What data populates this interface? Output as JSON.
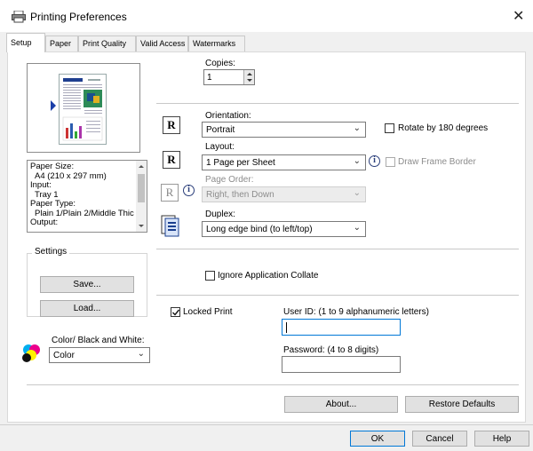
{
  "window": {
    "title": "Printing Preferences",
    "close_glyph": "✕"
  },
  "tabs": [
    {
      "label": "Setup",
      "active": true
    },
    {
      "label": "Paper"
    },
    {
      "label": "Print Quality"
    },
    {
      "label": "Valid Access"
    },
    {
      "label": "Watermarks"
    }
  ],
  "summary_lines": [
    "Paper Size:",
    "A4 (210 x 297 mm)",
    "Input:",
    "Tray 1",
    "Paper Type:",
    "Plain 1/Plain 2/Middle Thic",
    "Output:"
  ],
  "settings": {
    "legend": "Settings",
    "save_label": "Save...",
    "load_label": "Load..."
  },
  "color": {
    "label": "Color/ Black and White:",
    "value": "Color"
  },
  "copies": {
    "label": "Copies:",
    "value": "1"
  },
  "orientation": {
    "label": "Orientation:",
    "value": "Portrait",
    "rotate_label": "Rotate by 180 degrees",
    "rotate_checked": false
  },
  "layout": {
    "label": "Layout:",
    "value": "1 Page per Sheet",
    "draw_frame_label": "Draw Frame Border",
    "draw_frame_checked": false
  },
  "page_order": {
    "label": "Page Order:",
    "value": "Right, then Down"
  },
  "duplex": {
    "label": "Duplex:",
    "value": "Long edge bind (to left/top)"
  },
  "ignore_collate": {
    "label": "Ignore Application Collate",
    "checked": false
  },
  "locked_print": {
    "label": "Locked Print",
    "checked": true,
    "user_id_label": "User ID: (1 to 9 alphanumeric letters)",
    "user_id_value": "",
    "password_label": "Password: (4 to 8 digits)",
    "password_value": ""
  },
  "buttons": {
    "about": "About...",
    "restore": "Restore Defaults",
    "ok": "OK",
    "cancel": "Cancel",
    "help": "Help"
  },
  "icons": {
    "printer": "printer-icon",
    "r_orientation": "R",
    "r_layout": "R",
    "r_page_order": "R",
    "info": "i"
  }
}
